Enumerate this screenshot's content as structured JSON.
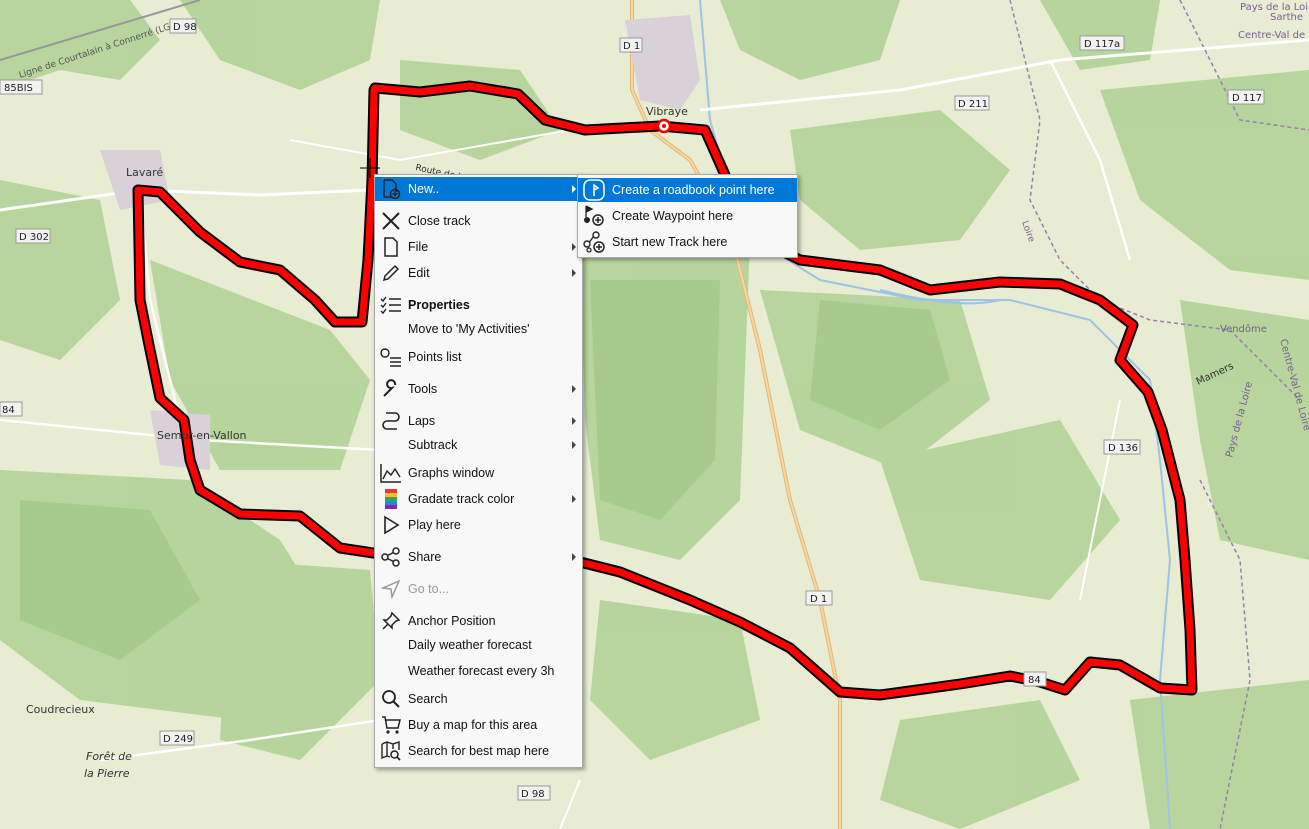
{
  "map": {
    "places": [
      "Lavaré",
      "Vibraye",
      "Semur-en-Vallon",
      "Coudrecieux",
      "Forêt de",
      "la Pierre",
      "Mamers",
      "Vendôme",
      "Pays de la Loire",
      "Centre-Val de Loire",
      "Sarthe",
      "Loire",
      "Route de Lavaré",
      "Ligne de Courtalain à Connerré (LGV)",
      "Pays de la Loire",
      "Centre-Val de Loire"
    ],
    "roads": [
      "D 98",
      "D 1",
      "D 211",
      "D 117a",
      "D 117",
      "85BIS",
      "D 302",
      "84",
      "D 136",
      "D 1",
      "D 249",
      "D 98",
      "84"
    ],
    "track_color": "#ff0000"
  },
  "context_menu": {
    "items": [
      {
        "label": "New..",
        "icon": "new-document-icon",
        "submenu": true,
        "highlighted": true
      },
      {
        "label": "Close track",
        "icon": "close-icon"
      },
      {
        "label": "File",
        "icon": "file-icon",
        "submenu": true
      },
      {
        "label": "Edit",
        "icon": "pencil-icon",
        "submenu": true
      },
      {
        "label": "Properties",
        "icon": "checklist-icon",
        "bold": true
      },
      {
        "label": "Move to 'My Activities'",
        "icon": ""
      },
      {
        "label": "Points list",
        "icon": "points-list-icon"
      },
      {
        "label": "Tools",
        "icon": "wrench-icon",
        "submenu": true
      },
      {
        "label": "Laps",
        "icon": "laps-icon",
        "submenu": true
      },
      {
        "label": "Subtrack",
        "icon": "",
        "submenu": true
      },
      {
        "label": "Graphs window",
        "icon": "graph-icon"
      },
      {
        "label": "Gradate track color",
        "icon": "color-gradient-icon",
        "submenu": true
      },
      {
        "label": "Play here",
        "icon": "play-icon"
      },
      {
        "label": "Share",
        "icon": "share-icon",
        "submenu": true
      },
      {
        "label": "Go to...",
        "icon": "navigate-arrow-icon",
        "disabled": true
      },
      {
        "label": "Anchor Position",
        "icon": "pin-icon"
      },
      {
        "label": "Daily weather forecast",
        "icon": ""
      },
      {
        "label": "Weather forecast every 3h",
        "icon": ""
      },
      {
        "label": "Search",
        "icon": "search-icon"
      },
      {
        "label": "Buy a map for this area",
        "icon": "cart-icon"
      },
      {
        "label": "Search for best map here",
        "icon": "map-search-icon"
      }
    ]
  },
  "submenu": {
    "items": [
      {
        "label": "Create a roadbook point here",
        "icon": "roadbook-icon",
        "highlighted": true
      },
      {
        "label": "Create Waypoint here",
        "icon": "waypoint-add-icon"
      },
      {
        "label": "Start new Track here",
        "icon": "track-add-icon"
      }
    ]
  },
  "colors": {
    "highlight": "#0078d7",
    "menu_bg": "#f8f8f8"
  }
}
